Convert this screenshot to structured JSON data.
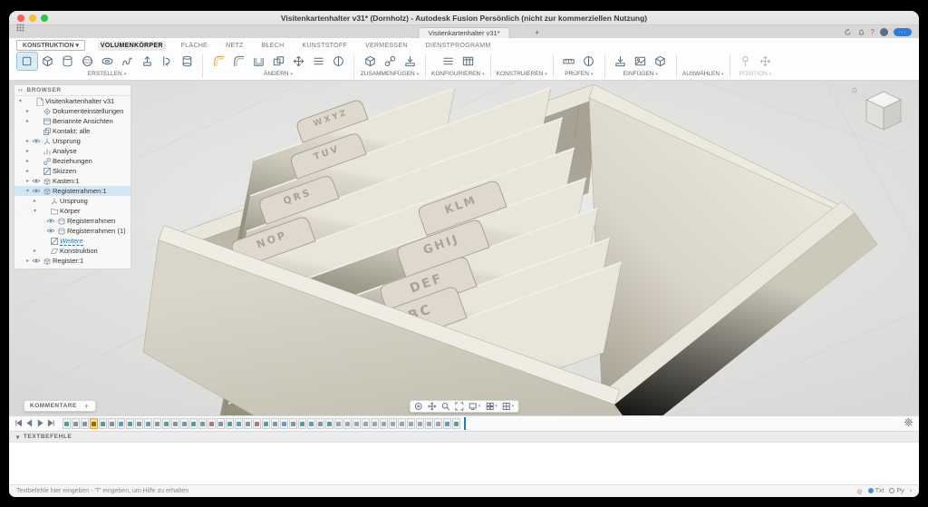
{
  "window": {
    "title": "Visitenkartenhalter v31* (Dornholz) - Autodesk Fusion Persönlich (nicht zur kommerziellen Nutzung)"
  },
  "tabstrip": {
    "doc_tab": "Visitenkartenhalter v31*",
    "add_tab": "+"
  },
  "ribbon": {
    "workspace": "KONSTRUKTION",
    "tabs": [
      {
        "label": "VOLUMENKÖRPER",
        "active": true
      },
      {
        "label": "FLÄCHE",
        "active": false
      },
      {
        "label": "NETZ",
        "active": false
      },
      {
        "label": "BLECH",
        "active": false
      },
      {
        "label": "KUNSTSTOFF",
        "active": false
      },
      {
        "label": "VERMESSEN",
        "active": false
      },
      {
        "label": "DIENSTPROGRAMM",
        "active": false
      }
    ],
    "groups": [
      {
        "label": "ERSTELLEN",
        "items": [
          {
            "icon": "sketchpen",
            "selected": true
          },
          {
            "icon": "cube"
          },
          {
            "icon": "cylinder"
          },
          {
            "icon": "sphere"
          },
          {
            "icon": "torus"
          },
          {
            "icon": "coil"
          },
          {
            "icon": "extrude"
          },
          {
            "icon": "revolve"
          },
          {
            "icon": "loft"
          }
        ]
      },
      {
        "label": "ÄNDERN",
        "items": [
          {
            "icon": "fillet",
            "accent": true
          },
          {
            "icon": "fillet"
          },
          {
            "icon": "shell"
          },
          {
            "icon": "combine"
          },
          {
            "icon": "move"
          },
          {
            "icon": "sliders"
          },
          {
            "icon": "section"
          }
        ]
      },
      {
        "label": "ZUSAMMENFÜGEN",
        "items": [
          {
            "icon": "cube"
          },
          {
            "icon": "joint"
          },
          {
            "icon": "insert"
          }
        ]
      },
      {
        "label": "KONFIGURIEREN",
        "items": [
          {
            "icon": "sliders"
          },
          {
            "icon": "table"
          }
        ]
      },
      {
        "label": "KONSTRUIEREN",
        "items": [
          {
            "icon": "plane"
          },
          {
            "icon": "plane"
          }
        ]
      },
      {
        "label": "PRÜFEN",
        "items": [
          {
            "icon": "measure"
          },
          {
            "icon": "section"
          }
        ]
      },
      {
        "label": "EINFÜGEN",
        "items": [
          {
            "icon": "insert"
          },
          {
            "icon": "decal"
          },
          {
            "icon": "cube"
          }
        ]
      },
      {
        "label": "AUSWÄHLEN",
        "items": [
          {
            "icon": "cursor"
          }
        ]
      },
      {
        "label": "POSITION",
        "disabled": true,
        "items": [
          {
            "icon": "pin"
          },
          {
            "icon": "move"
          }
        ]
      }
    ]
  },
  "browser": {
    "header": "BROWSER",
    "items": [
      {
        "label": "Visitenkartenhalter v31",
        "depth": 0,
        "icon": "doc",
        "chev": "open"
      },
      {
        "label": "Dokumenteinstellungen",
        "depth": 1,
        "icon": "gear",
        "chev": "closed"
      },
      {
        "label": "Benannte Ansichten",
        "depth": 1,
        "icon": "views",
        "chev": "closed"
      },
      {
        "label": "Kontakt: alle",
        "depth": 1,
        "icon": "contact"
      },
      {
        "label": "Ursprung",
        "depth": 1,
        "icon": "origin",
        "chev": "closed",
        "eye": true
      },
      {
        "label": "Analyse",
        "depth": 1,
        "icon": "analysis",
        "chev": "closed"
      },
      {
        "label": "Beziehungen",
        "depth": 1,
        "icon": "jointb",
        "chev": "closed"
      },
      {
        "label": "Skizzen",
        "depth": 1,
        "icon": "sketchf",
        "chev": "closed"
      },
      {
        "label": "Kasten:1",
        "depth": 1,
        "icon": "component",
        "chev": "closed",
        "eye": true
      },
      {
        "label": "Registerrahmen:1",
        "depth": 1,
        "icon": "component",
        "chev": "open",
        "eye": true,
        "selected": true
      },
      {
        "label": "Ursprung",
        "depth": 2,
        "icon": "origin",
        "chev": "closed"
      },
      {
        "label": "Körper",
        "depth": 2,
        "icon": "folder",
        "chev": "open"
      },
      {
        "label": "Registerrahmen",
        "depth": 3,
        "icon": "body",
        "eye": true
      },
      {
        "label": "Registerrahmen (1)",
        "depth": 3,
        "icon": "body",
        "eye": true
      },
      {
        "label": "Weitere",
        "depth": 2,
        "icon": "sketchf",
        "edit": true
      },
      {
        "label": "Konstruktion",
        "depth": 2,
        "icon": "construction",
        "chev": "closed"
      },
      {
        "label": "Register:1",
        "depth": 1,
        "icon": "component",
        "chev": "closed",
        "eye": true
      }
    ]
  },
  "viewport": {
    "dividers": [
      "WXYZ",
      "TUV",
      "QRS",
      "NOP",
      "KLM",
      "GHIJ",
      "DEF",
      "ABC"
    ]
  },
  "comments": {
    "label": "KOMMENTARE",
    "add": "+"
  },
  "navbar": {
    "tools": [
      "orbit",
      "pan",
      "zoom",
      "fit",
      "display",
      "grid",
      "viewports"
    ]
  },
  "timeline": {
    "items": [
      "sketch",
      "extrude",
      "extrude",
      "selected",
      "sketch",
      "extrude",
      "fillet",
      "sketch",
      "extrude",
      "fillet",
      "extrude",
      "sketch",
      "extrude",
      "fillet",
      "sketch",
      "extrude",
      "combine",
      "extrude",
      "sketch",
      "fillet",
      "extrude",
      "combine",
      "sketch",
      "extrude",
      "fillet",
      "extrude",
      "sketch",
      "fillet",
      "extrude",
      "sketch",
      "pattern",
      "pattern",
      "pattern",
      "pattern",
      "pattern",
      "pattern",
      "pattern",
      "pattern",
      "pattern",
      "pattern",
      "pattern",
      "pattern",
      "fillet",
      "sketch"
    ]
  },
  "textcommands": {
    "header": "TEXTBEFEHLE"
  },
  "statusbar": {
    "hint": "Textbefehle hier eingeben  -  'T' eingeben, um Hilfe zu erhalten",
    "modes": [
      {
        "label": "Txt",
        "active": true
      },
      {
        "label": "Py",
        "active": false
      }
    ]
  }
}
